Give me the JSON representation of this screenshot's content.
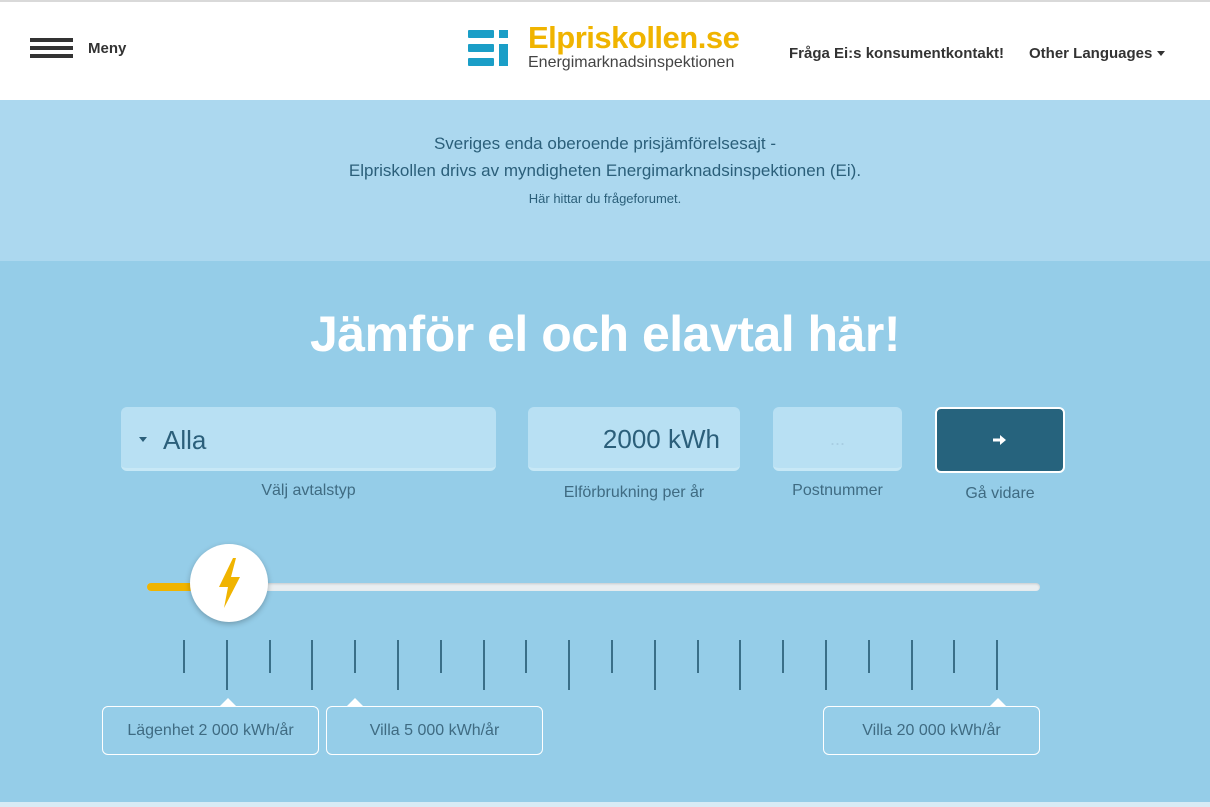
{
  "header": {
    "menu_label": "Meny",
    "logo_title": "Elpriskollen.se",
    "logo_subtitle": "Energimarknadsinspektionen",
    "contact_link": "Fråga Ei:s konsumentkontakt!",
    "languages_link": "Other Languages"
  },
  "intro": {
    "line1": "Sveriges enda oberoende prisjämförelsesajt -",
    "line2": "Elpriskollen drivs av myndigheten Energimarknadsinspektionen (Ei).",
    "forum_link": "Här hittar du frågeforumet."
  },
  "main": {
    "title": "Jämför el och elavtal här!",
    "contract_type": {
      "value": "Alla",
      "label": "Välj avtalstyp"
    },
    "consumption": {
      "value": "2000 kWh",
      "label": "Elförbrukning per år"
    },
    "postcode": {
      "placeholder": "...",
      "label": "Postnummer"
    },
    "go": {
      "label": "Gå vidare",
      "icon": "arrow-right-icon"
    }
  },
  "slider": {
    "value_kwh": 2000,
    "min_kwh": 0,
    "max_kwh": 20000,
    "icon": "lightning-icon",
    "accent_color": "#f0b400"
  },
  "presets": [
    {
      "label": "Lägenhet 2 000 kWh/år"
    },
    {
      "label": "Villa 5 000 kWh/år"
    },
    {
      "label": "Villa 20 000 kWh/år"
    }
  ],
  "colors": {
    "brand_yellow": "#f0b400",
    "brand_blue": "#1a9ec7",
    "button_dark": "#26637d",
    "page_bg": "#95cde8"
  }
}
